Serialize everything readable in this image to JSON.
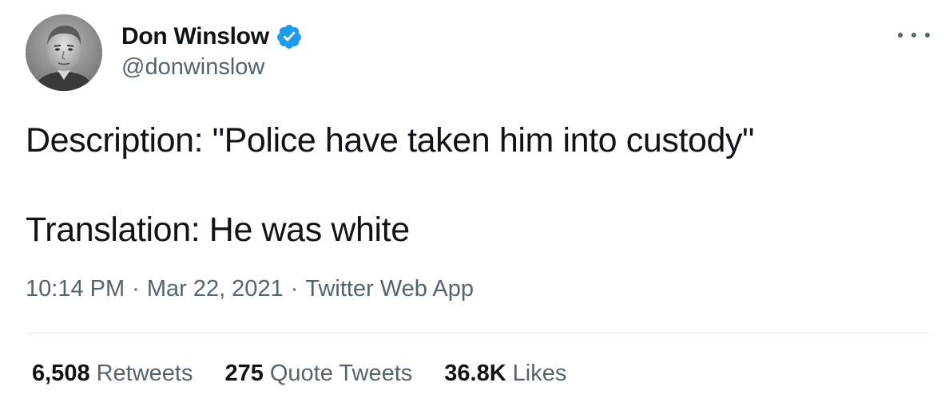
{
  "author": {
    "display_name": "Don Winslow",
    "handle": "@donwinslow",
    "verified": true,
    "verified_icon": "verified-badge-icon",
    "avatar": "profile-photo"
  },
  "tweet": {
    "line1": "Description: \"Police have taken him into custody\"",
    "line2": "Translation: He was white"
  },
  "meta": {
    "time": "10:14 PM",
    "separator": "·",
    "date": "Mar 22, 2021",
    "source": "Twitter Web App"
  },
  "stats": {
    "retweets_count": "6,508",
    "retweets_label": "Retweets",
    "quotes_count": "275",
    "quotes_label": "Quote Tweets",
    "likes_count": "36.8K",
    "likes_label": "Likes"
  },
  "colors": {
    "text_primary": "#0f1419",
    "text_secondary": "#536471",
    "verified_blue": "#1d9bf0",
    "divider": "#e6ecf0"
  }
}
